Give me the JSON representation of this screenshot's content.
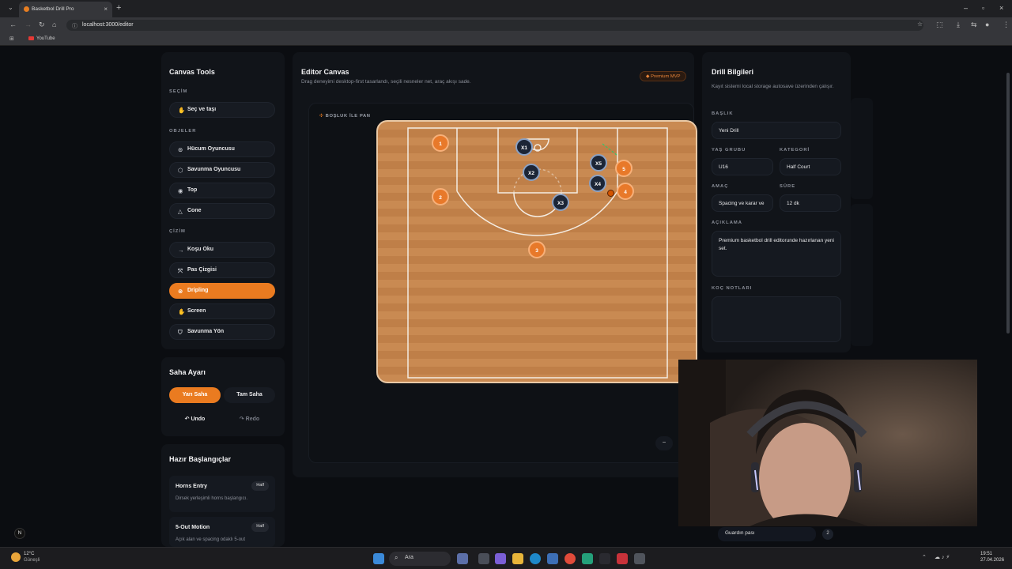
{
  "browser": {
    "tab_title": "Basketbol Drill Pro",
    "url": "localhost:3000/editor",
    "bookmark": "YouTube"
  },
  "tools": {
    "title": "Canvas Tools",
    "sec_selection": "SEÇİM",
    "select_move": "Seç ve taşı",
    "sec_objects": "OBJELER",
    "offense_player": "Hücum Oyuncusu",
    "defense_player": "Savunma Oyuncusu",
    "ball": "Top",
    "cone": "Cone",
    "sec_drawing": "ÇİZİM",
    "run_arrow": "Koşu Oku",
    "pass_line": "Pas Çizgisi",
    "dribbling": "Dripling",
    "screen": "Screen",
    "defense_direction": "Savunma Yön"
  },
  "court_settings": {
    "title": "Saha Ayarı",
    "half": "Yarı Saha",
    "full": "Tam Saha",
    "undo": "Undo",
    "redo": "Redo"
  },
  "presets": {
    "title": "Hazır Başlangıçlar",
    "items": [
      {
        "name": "Horns Entry",
        "tag": "Half",
        "desc": "Dirsek yerleşimli horns başlangıcı."
      },
      {
        "name": "5-Out Motion",
        "tag": "Half",
        "desc": "Açık alan ve spacing odaklı 5-out"
      }
    ]
  },
  "editor": {
    "title": "Editor Canvas",
    "subtitle": "Drag deneyimi desktop-first tasarlandı, seçili nesneler net, araç akışı sade.",
    "badge": "Premium MVP",
    "pan_hint": "BOŞLUK İLE PAN",
    "zoom_out": "−"
  },
  "players": {
    "offense": [
      "1",
      "2",
      "3",
      "4",
      "5"
    ],
    "defense": [
      "X1",
      "X2",
      "X3",
      "X4",
      "X5"
    ]
  },
  "drill": {
    "title": "Drill Bilgileri",
    "subtitle": "Kayıt sistemi local storage autosave üzerinden çalışır.",
    "lbl_title": "BAŞLIK",
    "title_value": "Yeni Drill",
    "lbl_age": "YAŞ GRUBU",
    "age_value": "U16",
    "lbl_category": "KATEGORİ",
    "category_value": "Half Court",
    "lbl_goal": "AMAÇ",
    "goal_value": "Spacing ve karar ve",
    "lbl_duration": "SÜRE",
    "duration_value": "12 dk",
    "lbl_desc": "AÇIKLAMA",
    "desc_value": "Premium basketbol drill editorunde hazırlanan yeni set.",
    "lbl_notes": "KOÇ NOTLARI",
    "notes_value": "",
    "step_name": "Guardın pası",
    "step_num": "2"
  },
  "taskbar": {
    "weather_temp": "12°C",
    "weather_desc": "Güneşli",
    "search": "Ara",
    "time": "19:51",
    "date": "27.04.2026"
  },
  "colors": {
    "accent": "#ea7b20",
    "panel": "#111419",
    "court": "#c98a52"
  }
}
